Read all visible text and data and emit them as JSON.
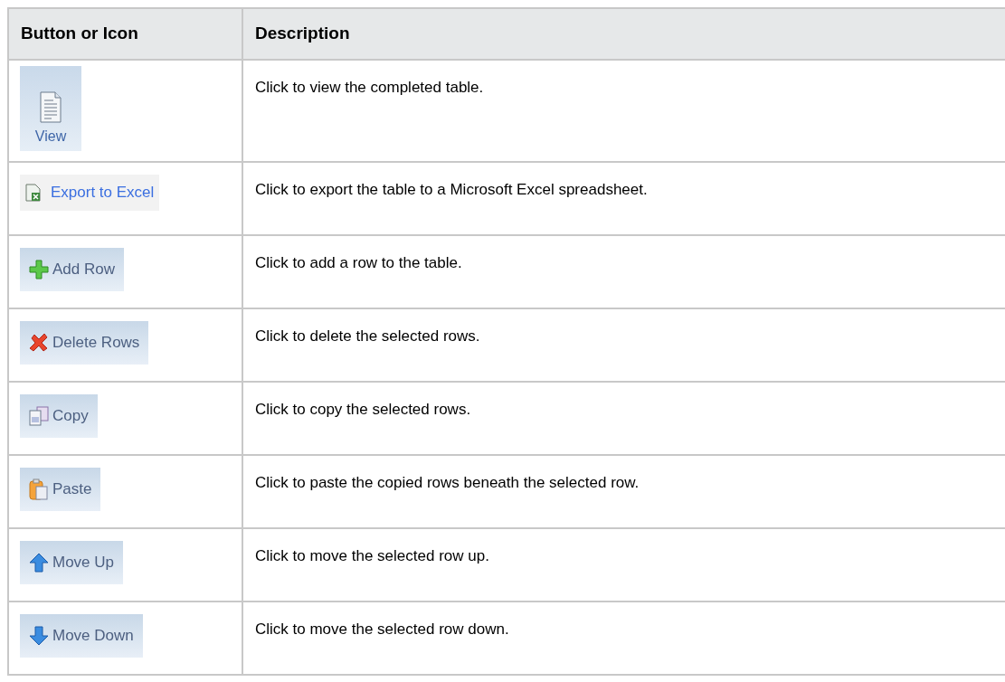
{
  "table": {
    "columns": [
      "Button or Icon",
      "Description"
    ],
    "rows": [
      {
        "button": {
          "label": "View",
          "kind": "large"
        },
        "description": "Click to view the completed table."
      },
      {
        "button": {
          "label": "Export to Excel",
          "kind": "link"
        },
        "description": "Click to export the table to a Microsoft Excel spreadsheet."
      },
      {
        "button": {
          "label": "Add Row",
          "kind": "toolbar"
        },
        "description": "Click to add a row to the table."
      },
      {
        "button": {
          "label": "Delete Rows",
          "kind": "toolbar"
        },
        "description": "Click to delete the selected rows."
      },
      {
        "button": {
          "label": "Copy",
          "kind": "toolbar"
        },
        "description": "Click to copy the selected rows."
      },
      {
        "button": {
          "label": "Paste",
          "kind": "toolbar"
        },
        "description": "Click to paste the copied rows beneath the selected row."
      },
      {
        "button": {
          "label": "Move Up",
          "kind": "toolbar"
        },
        "description": "Click to move the selected row up."
      },
      {
        "button": {
          "label": "Move Down",
          "kind": "toolbar"
        },
        "description": "Click to move the selected row down."
      }
    ]
  }
}
